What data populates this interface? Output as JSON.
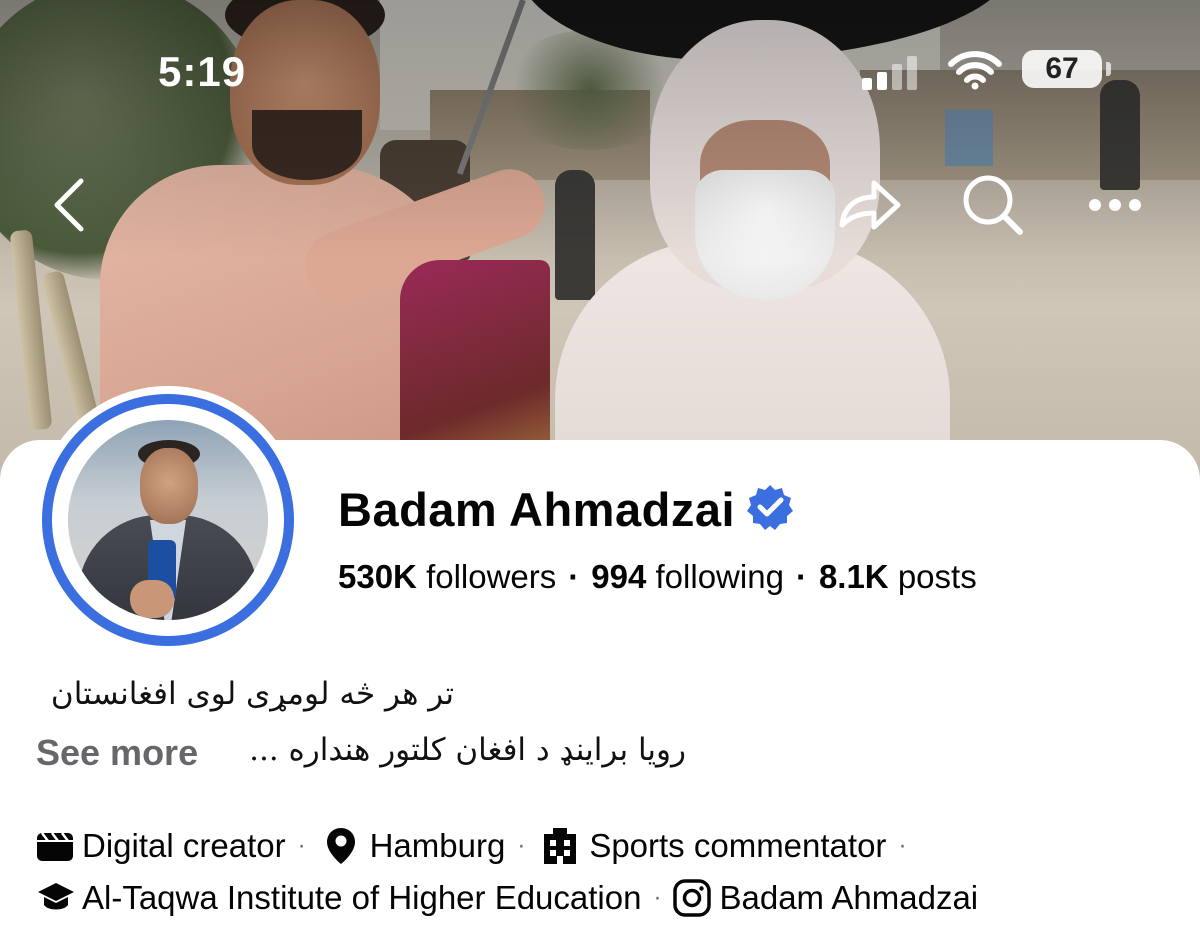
{
  "status_bar": {
    "time": "5:19",
    "battery": "67"
  },
  "nav": {
    "back_icon": "chevron-left-icon",
    "share_icon": "share-arrow-icon",
    "search_icon": "search-icon",
    "more_icon": "more-horizontal-icon"
  },
  "profile": {
    "name": "Badam Ahmadzai",
    "verified": true,
    "verified_color": "#3b6fe0",
    "stats": {
      "followers_count": "530K",
      "followers_label": "followers",
      "following_count": "994",
      "following_label": "following",
      "posts_count": "8.1K",
      "posts_label": "posts",
      "separator": "·"
    },
    "bio": {
      "line1": "تر هر څه لومړی لوی افغانستان",
      "line2": "رویا براینډ د افغان کلتور هنداره ...",
      "see_more": "See more"
    },
    "details": [
      {
        "icon": "clapperboard-icon",
        "text": "Digital creator"
      },
      {
        "icon": "location-pin-icon",
        "text": "Hamburg"
      },
      {
        "icon": "building-icon",
        "text": "Sports commentator"
      },
      {
        "icon": "graduation-cap-icon",
        "text": "Al-Taqwa Institute of Higher Education"
      },
      {
        "icon": "instagram-icon",
        "text": "Badam Ahmadzai"
      }
    ],
    "detail_separator": "·"
  },
  "colors": {
    "accent": "#3b6fe0",
    "secondary_text": "#65676b",
    "primary_text": "#050505"
  }
}
